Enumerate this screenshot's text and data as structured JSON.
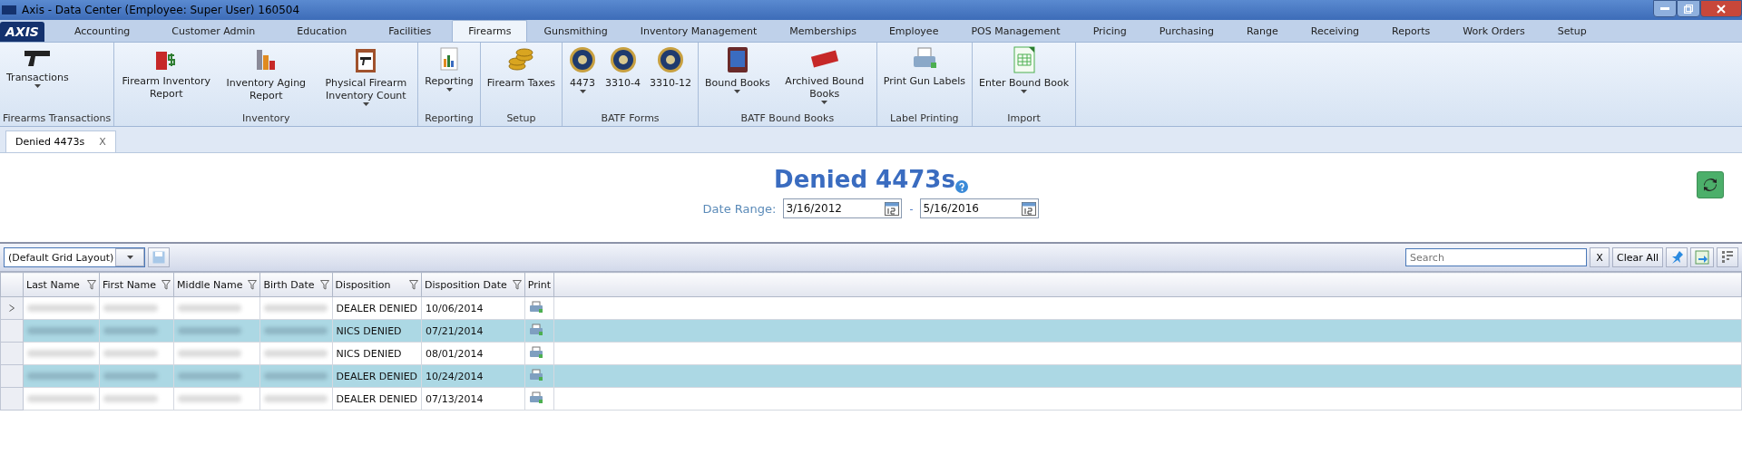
{
  "window": {
    "title": "Axis - Data Center  (Employee: Super User) 160504"
  },
  "logo": "AXIS",
  "tabs": [
    {
      "label": "Accounting",
      "selected": false
    },
    {
      "label": "Customer Admin",
      "selected": false
    },
    {
      "label": "Education",
      "selected": false
    },
    {
      "label": "Facilities",
      "selected": false
    },
    {
      "label": "Firearms",
      "selected": true
    },
    {
      "label": "Gunsmithing",
      "selected": false
    },
    {
      "label": "Inventory Management",
      "selected": false
    },
    {
      "label": "Memberships",
      "selected": false
    },
    {
      "label": "Employee",
      "selected": false
    },
    {
      "label": "POS Management",
      "selected": false
    },
    {
      "label": "Pricing",
      "selected": false
    },
    {
      "label": "Purchasing",
      "selected": false
    },
    {
      "label": "Range",
      "selected": false
    },
    {
      "label": "Receiving",
      "selected": false
    },
    {
      "label": "Reports",
      "selected": false
    },
    {
      "label": "Work Orders",
      "selected": false
    },
    {
      "label": "Setup",
      "selected": false
    }
  ],
  "ribbon_groups": [
    {
      "label": "Firearms Transactions",
      "items": [
        {
          "label": "Transactions",
          "dropdown": true
        }
      ]
    },
    {
      "label": "Inventory",
      "items": [
        {
          "label": "Firearm Inventory Report",
          "dropdown": false
        },
        {
          "label": "Inventory Aging Report",
          "dropdown": false
        },
        {
          "label": "Physical Firearm Inventory Count",
          "dropdown": true
        }
      ]
    },
    {
      "label": "Reporting",
      "items": [
        {
          "label": "Reporting",
          "dropdown": true
        }
      ]
    },
    {
      "label": "Setup",
      "items": [
        {
          "label": "Firearm Taxes",
          "dropdown": false
        }
      ]
    },
    {
      "label": "BATF Forms",
      "items": [
        {
          "label": "4473",
          "dropdown": true
        },
        {
          "label": "3310-4",
          "dropdown": false
        },
        {
          "label": "3310-12",
          "dropdown": false
        }
      ]
    },
    {
      "label": "BATF Bound Books",
      "items": [
        {
          "label": "Bound Books",
          "dropdown": true
        },
        {
          "label": "Archived Bound Books",
          "dropdown": true
        }
      ]
    },
    {
      "label": "Label Printing",
      "items": [
        {
          "label": "Print Gun Labels",
          "dropdown": false
        }
      ]
    },
    {
      "label": "Import",
      "items": [
        {
          "label": "Enter Bound Book",
          "dropdown": true
        }
      ]
    }
  ],
  "document_tabs": [
    {
      "label": "Denied 4473s",
      "close": "X",
      "selected": true
    }
  ],
  "page": {
    "title": "Denied 4473s",
    "date_range": {
      "label": "Date Range:",
      "from": "3/16/2012",
      "separator": "-",
      "to": "5/16/2016"
    }
  },
  "grid_toolbar": {
    "layout": "(Default Grid Layout)",
    "search": {
      "placeholder": "Search"
    },
    "clear": "X",
    "clear_all": "Clear All"
  },
  "table": {
    "columns": [
      {
        "label": "Last Name",
        "filter": true,
        "blurred": true
      },
      {
        "label": "First Name",
        "filter": true,
        "blurred": true
      },
      {
        "label": "Middle Name",
        "filter": true,
        "blurred": true
      },
      {
        "label": "Birth Date",
        "filter": true,
        "blurred": true
      },
      {
        "label": "Disposition",
        "filter": true,
        "blurred": false
      },
      {
        "label": "Disposition Date",
        "filter": true,
        "blurred": false
      },
      {
        "label": "Print",
        "filter": false,
        "blurred": false
      }
    ],
    "rows": [
      {
        "current": true,
        "shaded": false,
        "disposition": "DEALER DENIED",
        "date": "10/06/2014"
      },
      {
        "current": false,
        "shaded": true,
        "disposition": "NICS DENIED",
        "date": "07/21/2014"
      },
      {
        "current": false,
        "shaded": false,
        "disposition": "NICS DENIED",
        "date": "08/01/2014"
      },
      {
        "current": false,
        "shaded": true,
        "disposition": "DEALER DENIED",
        "date": "10/24/2014"
      },
      {
        "current": false,
        "shaded": false,
        "disposition": "DEALER DENIED",
        "date": "07/13/2014"
      }
    ]
  }
}
